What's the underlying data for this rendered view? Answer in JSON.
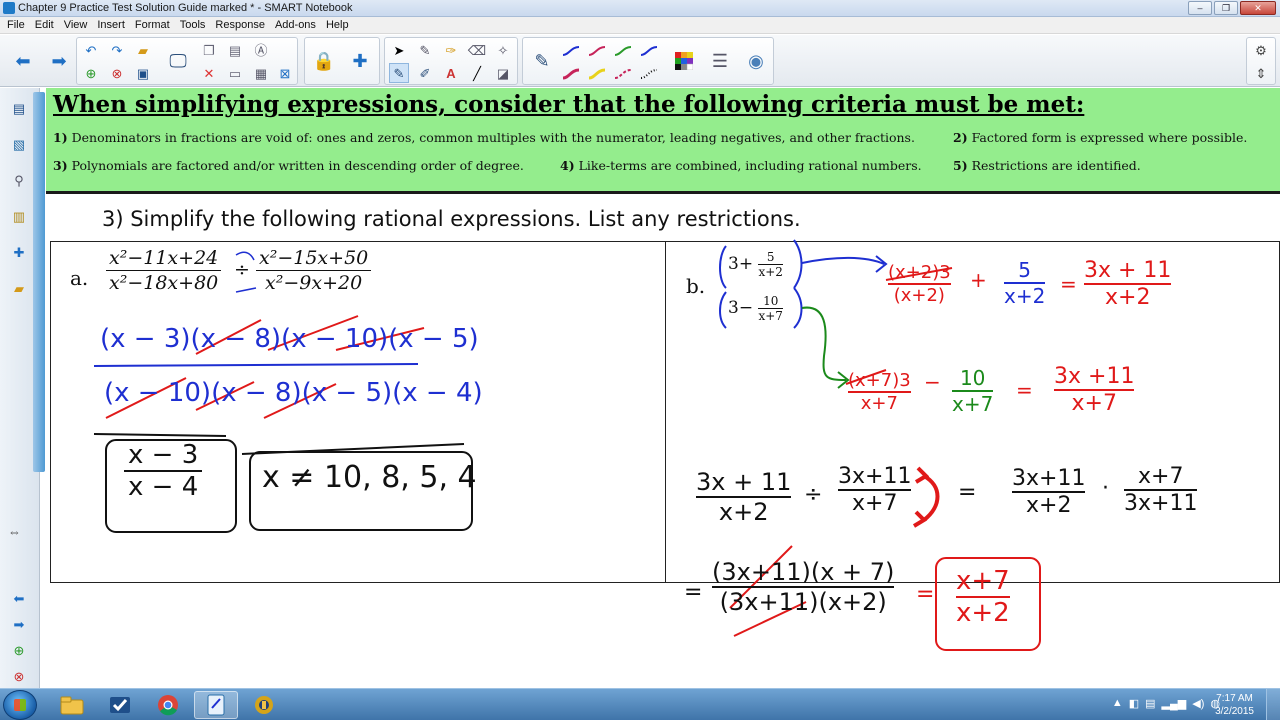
{
  "window": {
    "title": "Chapter 9 Practice Test Solution Guide marked * - SMART Notebook",
    "minimize": "–",
    "maximize": "❐",
    "close": "✕"
  },
  "menu": [
    "File",
    "Edit",
    "View",
    "Insert",
    "Format",
    "Tools",
    "Response",
    "Add-ons",
    "Help"
  ],
  "toolbar": {
    "back_icon": "arrow-left-icon",
    "forward_icon": "arrow-right-icon",
    "pen_colors": [
      "#1e2fd1",
      "#c6245a",
      "#2a9a2a",
      "#1e2fd1",
      "#c6245a",
      "#e8d21a",
      "#c6245a",
      "#111111"
    ]
  },
  "slide": {
    "criteria_heading": "When simplifying expressions, consider that the following criteria must be met:",
    "criteria": [
      {
        "num": "1)",
        "text": " Denominators in fractions are void of: ones and zeros, common multiples with the numerator, leading negatives, and other fractions."
      },
      {
        "num": "2)",
        "text": " Factored form is expressed where possible."
      },
      {
        "num": "3)",
        "text": " Polynomials are factored and/or written in descending order of degree."
      },
      {
        "num": "4)",
        "text": " Like-terms are combined, including rational numbers."
      },
      {
        "num": "5)",
        "text": " Restrictions are identified."
      }
    ],
    "question": "3)  Simplify the following rational expressions. List any restrictions.",
    "part_a": {
      "label": "a.",
      "frac1_num": "x²−11x+24",
      "frac1_den": "x²−18x+80",
      "operator": "÷",
      "frac2_num": "x²−15x+50",
      "frac2_den": "x²−9x+20",
      "work_num": "(x − 3)(x − 8)(x − 10)(x − 5)",
      "work_den": "(x − 10)(x − 8)(x − 5)(x − 4)",
      "answer_num": "x − 3",
      "answer_den": "x − 4",
      "restrictions": "x ≠ 10, 8, 5, 4"
    },
    "part_b": {
      "label": "b.",
      "top_expr_whole": "3+",
      "top_expr_num": "5",
      "top_expr_den": "x+2",
      "bot_expr_whole": "3−",
      "bot_expr_num": "10",
      "bot_expr_den": "x+7",
      "step1_lhs_num": "(x+2)3",
      "step1_lhs_den": "(x+2)",
      "step1_plus": "+",
      "step1_rhs_num": "5",
      "step1_rhs_den": "x+2",
      "step1_eq": "=",
      "step1_res_num": "3x + 11",
      "step1_res_den": "x+2",
      "step2_lhs_num": "(x+7)3",
      "step2_lhs_den": "x+7",
      "step2_minus": "−",
      "step2_rhs_num": "10",
      "step2_rhs_den": "x+7",
      "step2_eq": "=",
      "step2_res_num": "3x +11",
      "step2_res_den": "x+7",
      "step3_a_num": "3x + 11",
      "step3_a_den": "x+2",
      "step3_div": "÷",
      "step3_b_num": "3x+11",
      "step3_b_den": "x+7",
      "step3_eq": "=",
      "step3_c_num": "3x+11",
      "step3_c_den": "x+2",
      "step3_dot": "·",
      "step3_d_num": "x+7",
      "step3_d_den": "3x+11",
      "step4_eq": "=",
      "step4_num": "(3x+11)(x + 7)",
      "step4_den": "(3x+11)(x+2)",
      "step4_eq2": "=",
      "final_num": "x+7",
      "final_den": "x+2"
    }
  },
  "taskbar": {
    "time": "7:17 AM",
    "date": "3/2/2015",
    "apps": [
      "explorer-icon",
      "checkmark-app-icon",
      "chrome-icon",
      "notebook-icon",
      "recorder-icon"
    ]
  },
  "colors": {
    "criteria_bg": "#94ed8d",
    "ink_blue": "#1e2fd1",
    "ink_red": "#e01919",
    "ink_green": "#1b8a1b"
  }
}
